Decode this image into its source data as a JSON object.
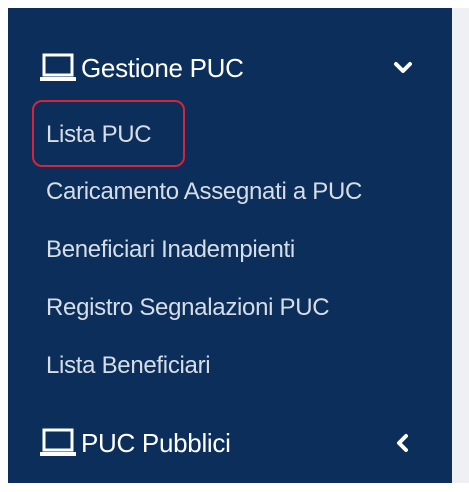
{
  "sidebar": {
    "sections": [
      {
        "label": "Gestione PUC",
        "icon": "laptop-icon",
        "chevron": "chevron-down-icon",
        "expanded": true
      },
      {
        "label": "PUC Pubblici",
        "icon": "laptop-icon",
        "chevron": "chevron-left-icon",
        "expanded": false
      }
    ],
    "submenu": [
      "Lista PUC",
      "Caricamento Assegnati a PUC",
      "Beneficiari Inadempienti",
      "Registro Segnalazioni PUC",
      "Lista Beneficiari"
    ]
  },
  "colors": {
    "sidebar_bg": "#0b2f5a",
    "submenu_text": "#d7dde6",
    "highlight": "#d9233a"
  }
}
